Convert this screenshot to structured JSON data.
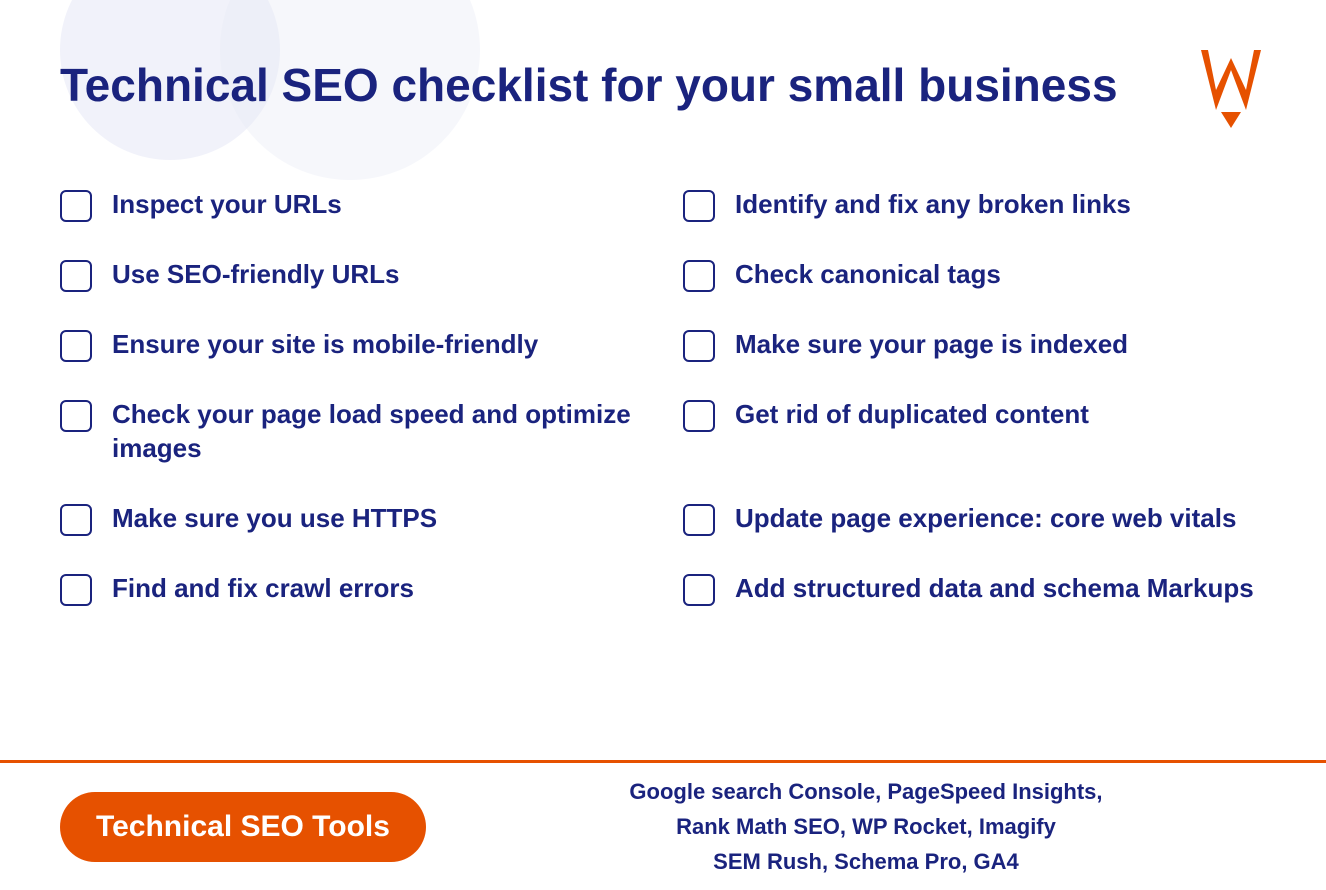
{
  "page": {
    "title": "Technical SEO checklist for your small business",
    "background_color": "#ffffff",
    "accent_color": "#e65100",
    "primary_color": "#1a237e"
  },
  "checklist": {
    "left_items": [
      {
        "id": 1,
        "text": "Inspect your URLs"
      },
      {
        "id": 2,
        "text": "Use SEO-friendly URLs"
      },
      {
        "id": 3,
        "text": "Ensure your site is mobile-friendly"
      },
      {
        "id": 4,
        "text": "Check your page load speed and optimize images"
      },
      {
        "id": 5,
        "text": "Make sure you use HTTPS"
      },
      {
        "id": 6,
        "text": "Find and fix crawl errors"
      }
    ],
    "right_items": [
      {
        "id": 7,
        "text": "Identify and fix any broken links"
      },
      {
        "id": 8,
        "text": "Check canonical tags"
      },
      {
        "id": 9,
        "text": "Make sure your page is indexed"
      },
      {
        "id": 10,
        "text": "Get rid of duplicated content"
      },
      {
        "id": 11,
        "text": "Update page experience: core web vitals"
      },
      {
        "id": 12,
        "text": "Add structured data and schema Markups"
      }
    ]
  },
  "footer": {
    "badge_text": "Technical SEO Tools",
    "tools_line1": "Google search Console, PageSpeed Insights,",
    "tools_line2": "Rank Math SEO, WP Rocket, Imagify",
    "tools_line3": "SEM Rush, Schema Pro, GA4"
  }
}
